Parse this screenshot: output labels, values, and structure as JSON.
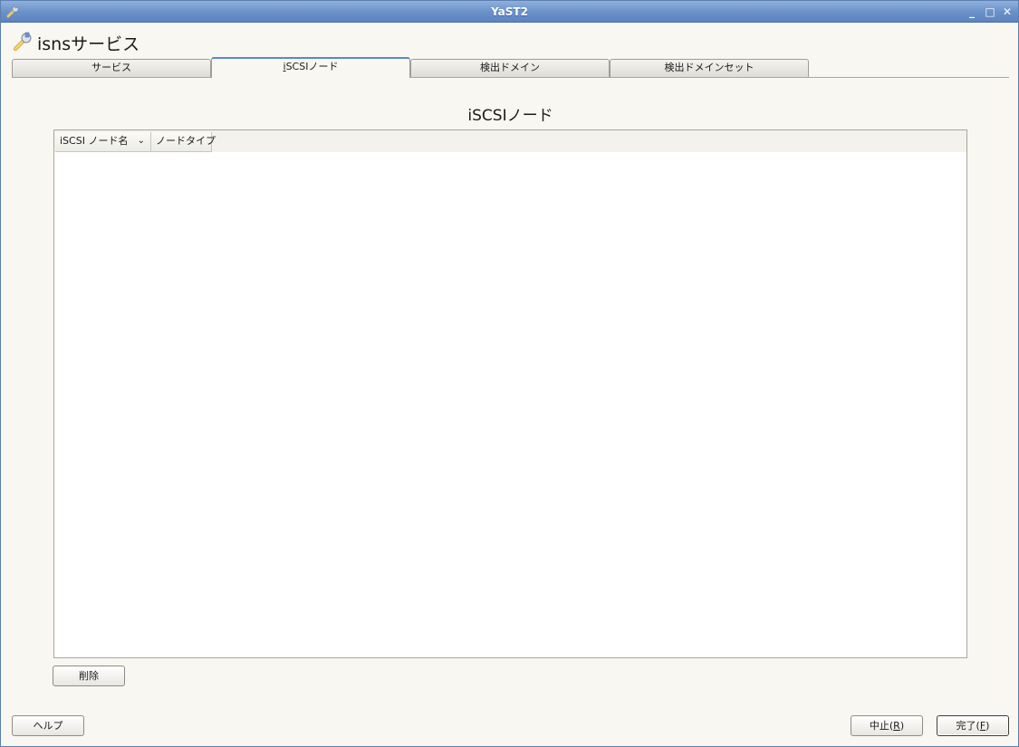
{
  "window": {
    "title": "YaST2",
    "minimize": "_",
    "maximize": "□",
    "close": "✕"
  },
  "header": {
    "title": "isnsサービス"
  },
  "tabs": [
    {
      "label_pre": "サービス",
      "label_ul": "",
      "label_post": ""
    },
    {
      "label_pre": "",
      "label_ul": "i",
      "label_post": "SCSIノード"
    },
    {
      "label_pre": "検出ドメイン",
      "label_ul": "",
      "label_post": ""
    },
    {
      "label_pre": "検出ドメインセット",
      "label_ul": "",
      "label_post": ""
    }
  ],
  "main": {
    "section_title": "iSCSIノード",
    "table": {
      "columns": [
        {
          "label": "iSCSI ノード名"
        },
        {
          "label": "ノードタイプ"
        }
      ],
      "sort_indicator": "⌄",
      "rows": []
    },
    "delete_button": "削除"
  },
  "footer": {
    "help": "ヘルプ",
    "abort_pre": "中止(",
    "abort_key": "R",
    "abort_post": ")",
    "finish_pre": "完了(",
    "finish_key": "F",
    "finish_post": ")"
  },
  "colors": {
    "titlebar": "#6a90c8",
    "active_tab_accent": "#5b88c9",
    "background": "#f9f7f1"
  }
}
